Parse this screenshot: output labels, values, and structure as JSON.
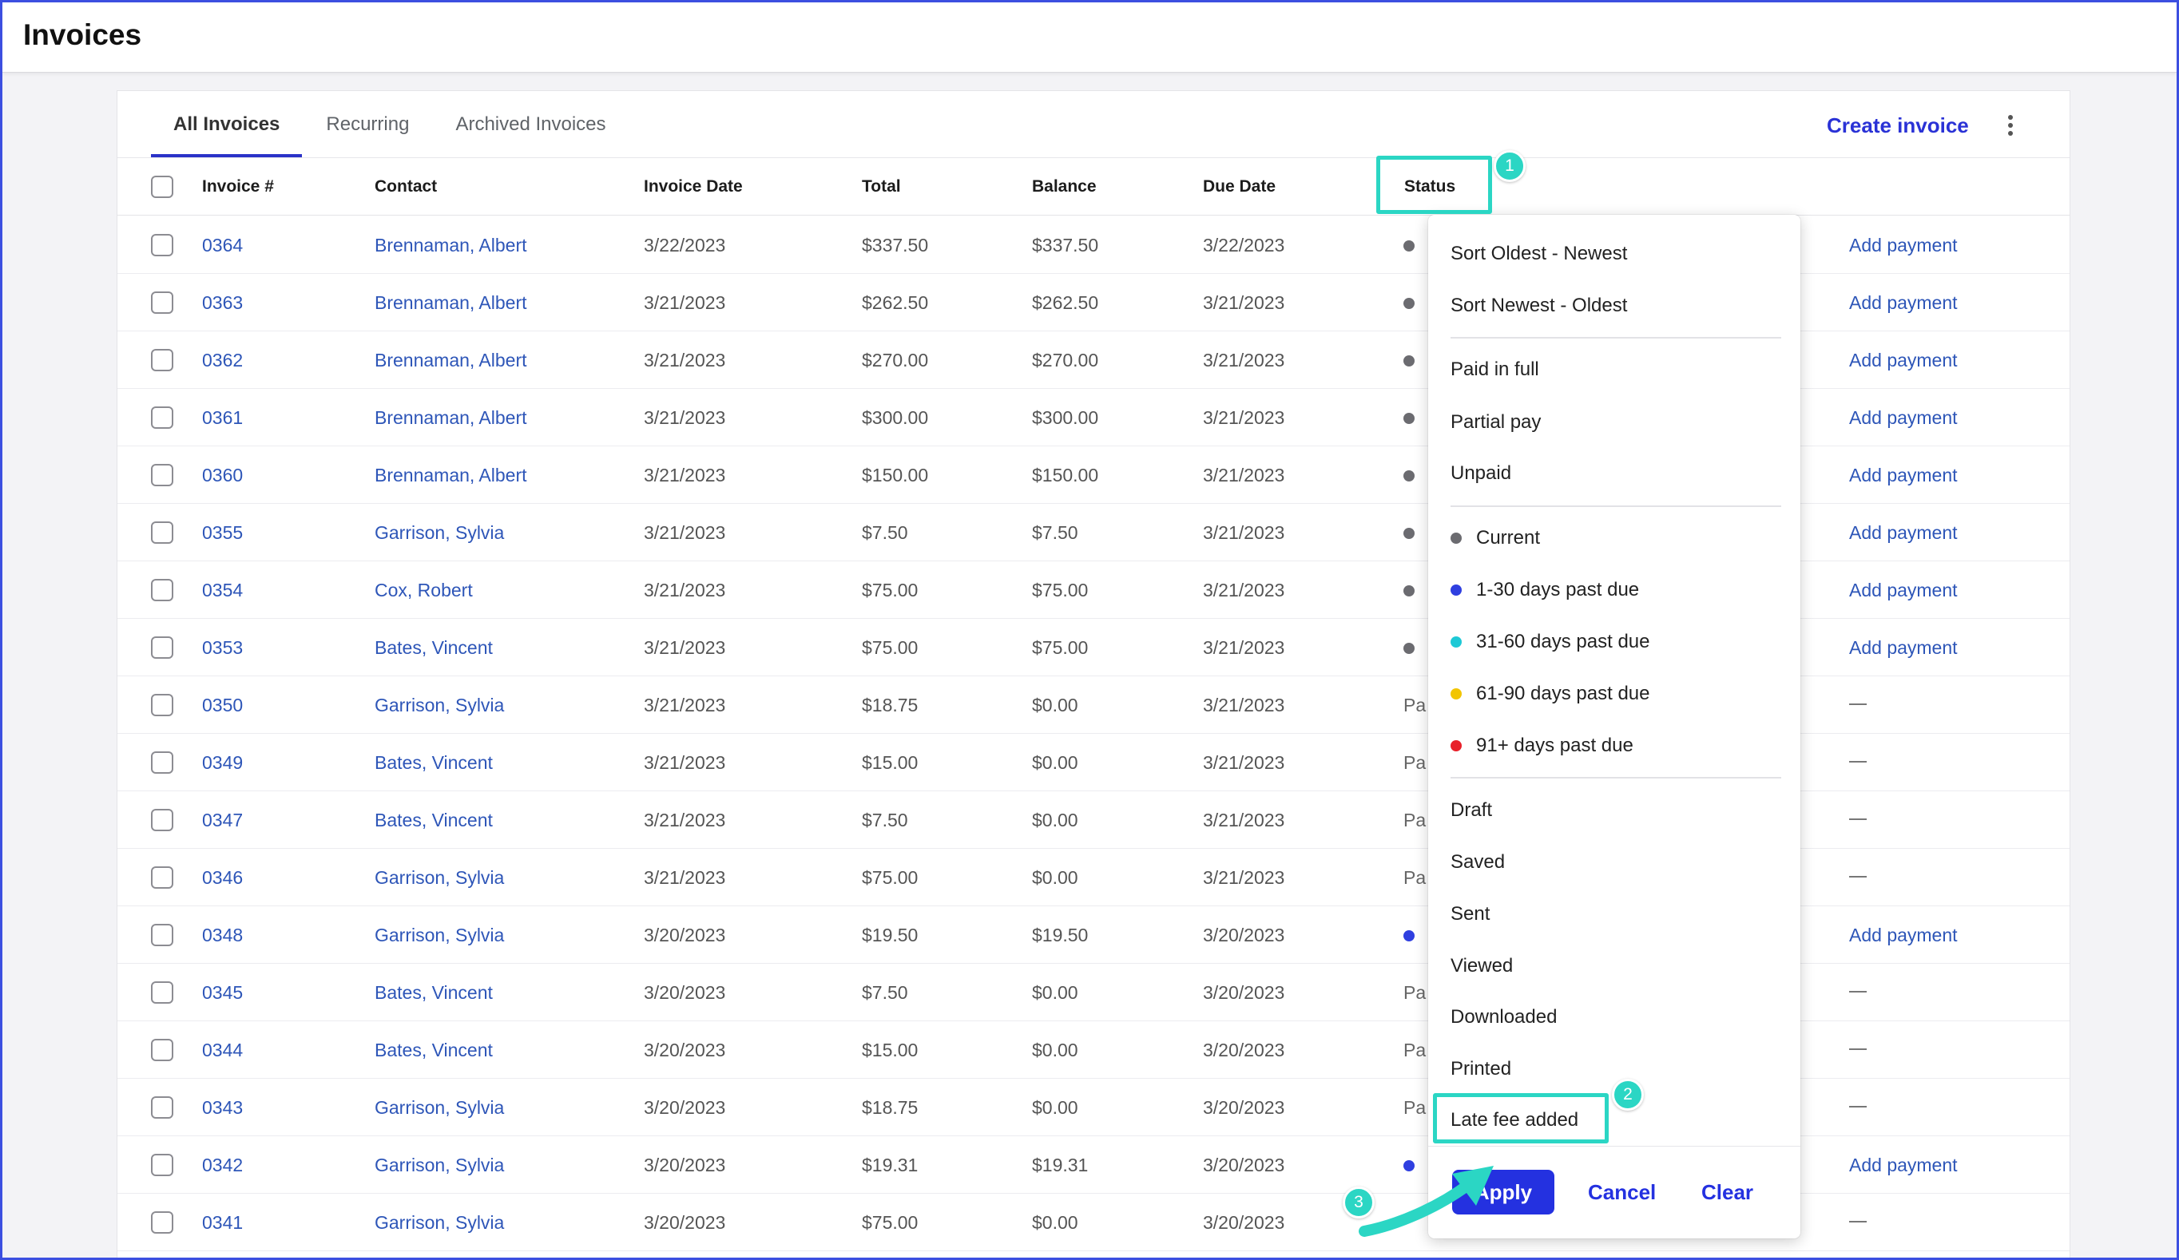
{
  "page": {
    "title": "Invoices"
  },
  "tabs": [
    {
      "label": "All Invoices",
      "active": true
    },
    {
      "label": "Recurring",
      "active": false
    },
    {
      "label": "Archived Invoices",
      "active": false
    }
  ],
  "actions": {
    "create_invoice": "Create invoice",
    "more_icon": "kebab-vertical-icon"
  },
  "table": {
    "columns": [
      "Invoice #",
      "Contact",
      "Invoice Date",
      "Total",
      "Balance",
      "Due Date",
      "Status"
    ],
    "rows": [
      {
        "number": "0364",
        "contact": "Brennaman, Albert",
        "invoice_date": "3/22/2023",
        "total": "$337.50",
        "balance": "$337.50",
        "due_date": "3/22/2023",
        "status_dot": "#6b6b70",
        "status_text": "",
        "action": "Add payment"
      },
      {
        "number": "0363",
        "contact": "Brennaman, Albert",
        "invoice_date": "3/21/2023",
        "total": "$262.50",
        "balance": "$262.50",
        "due_date": "3/21/2023",
        "status_dot": "#6b6b70",
        "status_text": "",
        "action": "Add payment"
      },
      {
        "number": "0362",
        "contact": "Brennaman, Albert",
        "invoice_date": "3/21/2023",
        "total": "$270.00",
        "balance": "$270.00",
        "due_date": "3/21/2023",
        "status_dot": "#6b6b70",
        "status_text": "",
        "action": "Add payment"
      },
      {
        "number": "0361",
        "contact": "Brennaman, Albert",
        "invoice_date": "3/21/2023",
        "total": "$300.00",
        "balance": "$300.00",
        "due_date": "3/21/2023",
        "status_dot": "#6b6b70",
        "status_text": "",
        "action": "Add payment"
      },
      {
        "number": "0360",
        "contact": "Brennaman, Albert",
        "invoice_date": "3/21/2023",
        "total": "$150.00",
        "balance": "$150.00",
        "due_date": "3/21/2023",
        "status_dot": "#6b6b70",
        "status_text": "",
        "action": "Add payment"
      },
      {
        "number": "0355",
        "contact": "Garrison, Sylvia",
        "invoice_date": "3/21/2023",
        "total": "$7.50",
        "balance": "$7.50",
        "due_date": "3/21/2023",
        "status_dot": "#6b6b70",
        "status_text": "",
        "action": "Add payment"
      },
      {
        "number": "0354",
        "contact": "Cox, Robert",
        "invoice_date": "3/21/2023",
        "total": "$75.00",
        "balance": "$75.00",
        "due_date": "3/21/2023",
        "status_dot": "#6b6b70",
        "status_text": "",
        "action": "Add payment"
      },
      {
        "number": "0353",
        "contact": "Bates, Vincent",
        "invoice_date": "3/21/2023",
        "total": "$75.00",
        "balance": "$75.00",
        "due_date": "3/21/2023",
        "status_dot": "#6b6b70",
        "status_text": "",
        "action": "Add payment"
      },
      {
        "number": "0350",
        "contact": "Garrison, Sylvia",
        "invoice_date": "3/21/2023",
        "total": "$18.75",
        "balance": "$0.00",
        "due_date": "3/21/2023",
        "status_dot": "",
        "status_text": "Pa",
        "action": ""
      },
      {
        "number": "0349",
        "contact": "Bates, Vincent",
        "invoice_date": "3/21/2023",
        "total": "$15.00",
        "balance": "$0.00",
        "due_date": "3/21/2023",
        "status_dot": "",
        "status_text": "Pa",
        "action": ""
      },
      {
        "number": "0347",
        "contact": "Bates, Vincent",
        "invoice_date": "3/21/2023",
        "total": "$7.50",
        "balance": "$0.00",
        "due_date": "3/21/2023",
        "status_dot": "",
        "status_text": "Pa",
        "action": ""
      },
      {
        "number": "0346",
        "contact": "Garrison, Sylvia",
        "invoice_date": "3/21/2023",
        "total": "$75.00",
        "balance": "$0.00",
        "due_date": "3/21/2023",
        "status_dot": "",
        "status_text": "Pa",
        "action": ""
      },
      {
        "number": "0348",
        "contact": "Garrison, Sylvia",
        "invoice_date": "3/20/2023",
        "total": "$19.50",
        "balance": "$19.50",
        "due_date": "3/20/2023",
        "status_dot": "#2f3fe0",
        "status_text": "",
        "action": "Add payment"
      },
      {
        "number": "0345",
        "contact": "Bates, Vincent",
        "invoice_date": "3/20/2023",
        "total": "$7.50",
        "balance": "$0.00",
        "due_date": "3/20/2023",
        "status_dot": "",
        "status_text": "Pa",
        "action": ""
      },
      {
        "number": "0344",
        "contact": "Bates, Vincent",
        "invoice_date": "3/20/2023",
        "total": "$15.00",
        "balance": "$0.00",
        "due_date": "3/20/2023",
        "status_dot": "",
        "status_text": "Pa",
        "action": ""
      },
      {
        "number": "0343",
        "contact": "Garrison, Sylvia",
        "invoice_date": "3/20/2023",
        "total": "$18.75",
        "balance": "$0.00",
        "due_date": "3/20/2023",
        "status_dot": "",
        "status_text": "Pa",
        "action": ""
      },
      {
        "number": "0342",
        "contact": "Garrison, Sylvia",
        "invoice_date": "3/20/2023",
        "total": "$19.31",
        "balance": "$19.31",
        "due_date": "3/20/2023",
        "status_dot": "#2f3fe0",
        "status_text": "",
        "action": "Add payment"
      },
      {
        "number": "0341",
        "contact": "Garrison, Sylvia",
        "invoice_date": "3/20/2023",
        "total": "$75.00",
        "balance": "$0.00",
        "due_date": "3/20/2023",
        "status_dot": "",
        "status_text": "",
        "action": ""
      }
    ]
  },
  "status_menu": {
    "sort": [
      "Sort Oldest - Newest",
      "Sort Newest - Oldest"
    ],
    "payment": [
      "Paid in full",
      "Partial pay",
      "Unpaid"
    ],
    "aging": [
      {
        "label": "Current",
        "color": "#6b6b70"
      },
      {
        "label": "1-30 days past due",
        "color": "#2f3fe0"
      },
      {
        "label": "31-60 days past due",
        "color": "#1ec9d6"
      },
      {
        "label": "61-90 days past due",
        "color": "#f2c500"
      },
      {
        "label": "91+ days past due",
        "color": "#e8202a"
      }
    ],
    "states": [
      "Draft",
      "Saved",
      "Sent",
      "Viewed",
      "Downloaded",
      "Printed",
      "Late fee added"
    ],
    "buttons": {
      "apply": "Apply",
      "cancel": "Cancel",
      "clear": "Clear"
    }
  },
  "annotations": {
    "step1": "1",
    "step2": "2",
    "step3": "3",
    "highlight_color": "#2bd6c4"
  }
}
